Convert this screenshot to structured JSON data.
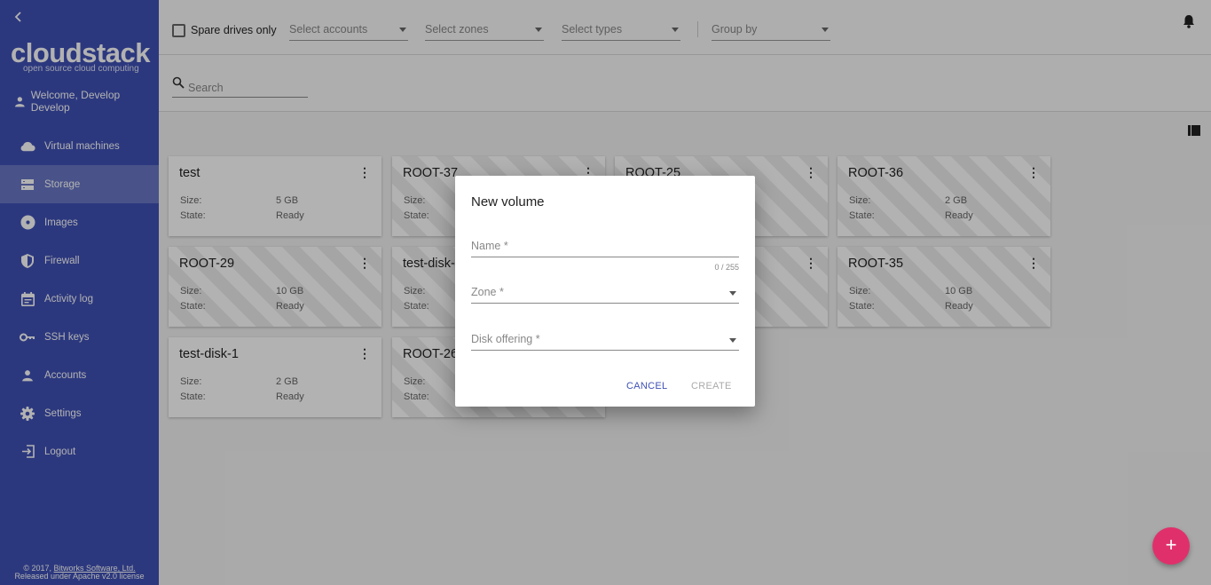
{
  "sidebar": {
    "back_icon": "chevron-left-icon",
    "logo": "cloudstack",
    "logo_sub": "open source cloud computing",
    "welcome": "Welcome, Develop Develop",
    "items": [
      {
        "label": "Virtual machines",
        "icon": "cloud-icon"
      },
      {
        "label": "Storage",
        "icon": "storage-icon",
        "active": true
      },
      {
        "label": "Images",
        "icon": "disc-icon"
      },
      {
        "label": "Firewall",
        "icon": "shield-icon"
      },
      {
        "label": "Activity log",
        "icon": "calendar-icon"
      },
      {
        "label": "SSH keys",
        "icon": "key-icon"
      },
      {
        "label": "Accounts",
        "icon": "person-icon"
      },
      {
        "label": "Settings",
        "icon": "gear-icon"
      },
      {
        "label": "Logout",
        "icon": "logout-icon"
      }
    ],
    "footer_line1_prefix": "© 2017, ",
    "footer_link": "Bitworks Software, Ltd.",
    "footer_line2": "Released under Apache v2.0 license"
  },
  "filters": {
    "spare_label": "Spare drives only",
    "accounts_placeholder": "Select accounts",
    "zones_placeholder": "Select zones",
    "types_placeholder": "Select types",
    "group_by_placeholder": "Group by"
  },
  "search": {
    "placeholder": "Search"
  },
  "cards": [
    {
      "title": "test",
      "size_label": "Size:",
      "size": "5 GB",
      "state_label": "State:",
      "state": "Ready"
    },
    {
      "title": "ROOT-37",
      "size_label": "Size:",
      "size": "",
      "state_label": "State:",
      "state": ""
    },
    {
      "title": "ROOT-25",
      "size_label": "",
      "size": "",
      "state_label": "",
      "state": ""
    },
    {
      "title": "ROOT-36",
      "size_label": "Size:",
      "size": "2 GB",
      "state_label": "State:",
      "state": "Ready"
    },
    {
      "title": "ROOT-29",
      "size_label": "Size:",
      "size": "10 GB",
      "state_label": "State:",
      "state": "Ready"
    },
    {
      "title": "test-disk-1",
      "size_label": "Size:",
      "size": "",
      "state_label": "State:",
      "state": ""
    },
    {
      "title": "",
      "size_label": "",
      "size": "",
      "state_label": "",
      "state": ""
    },
    {
      "title": "ROOT-35",
      "size_label": "Size:",
      "size": "10 GB",
      "state_label": "State:",
      "state": "Ready"
    },
    {
      "title": "test-disk-1",
      "size_label": "Size:",
      "size": "2 GB",
      "state_label": "State:",
      "state": "Ready"
    },
    {
      "title": "ROOT-26",
      "size_label": "Size:",
      "size": "",
      "state_label": "State:",
      "state": ""
    }
  ],
  "dialog": {
    "title": "New volume",
    "name_label": "Name *",
    "name_counter": "0 / 255",
    "zone_label": "Zone *",
    "disk_offering_label": "Disk offering *",
    "cancel": "CANCEL",
    "create": "CREATE"
  },
  "fab": {
    "label": "+"
  },
  "colors": {
    "sidebar": "#3f51b5",
    "accent": "#e0306b",
    "primary_text": "#3f51b5"
  }
}
